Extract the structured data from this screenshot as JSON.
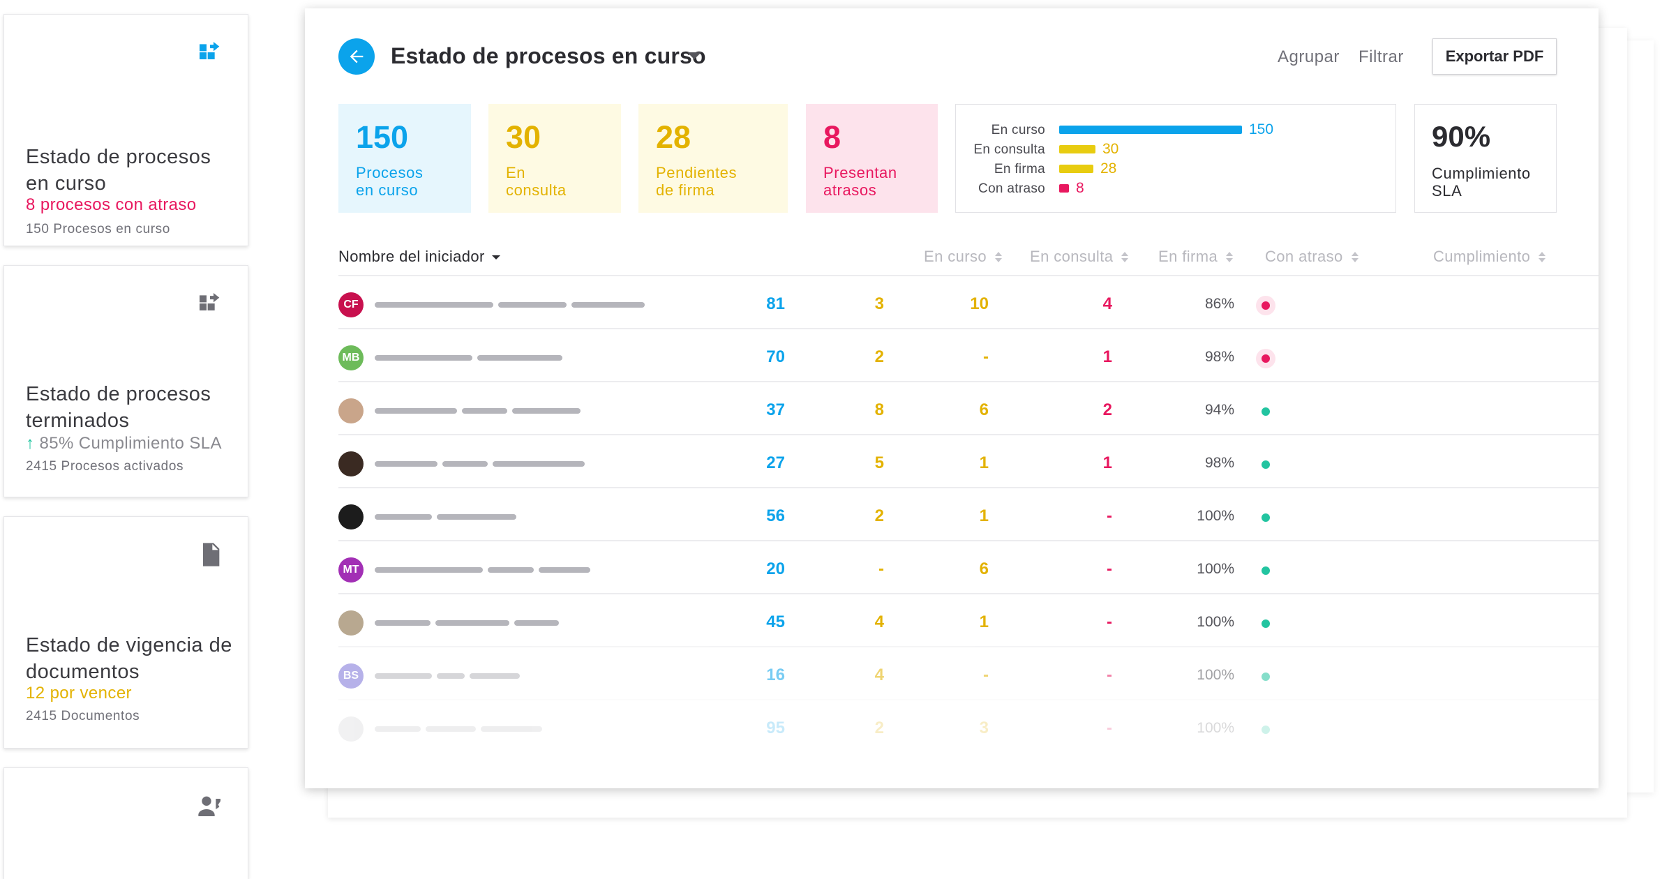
{
  "colors": {
    "blue": "#0ba3eb",
    "yellow": "#e3b200",
    "yellow_bar": "#e8cc10",
    "pink": "#e8185f",
    "green": "#22c4a0",
    "blue_bg": "#e6f6fd",
    "yellow_bg": "#fefae3",
    "pink_bg": "#fde3ec"
  },
  "cards": [
    {
      "icon": "process-export-icon",
      "title": "Estado de procesos en curso",
      "subtitle": "8 procesos con atraso",
      "meta": "150 Procesos en curso"
    },
    {
      "icon": "process-export-icon",
      "title": "Estado de procesos terminados",
      "subtitle": "85% Cumplimiento SLA",
      "meta": "2415 Procesos activados"
    },
    {
      "icon": "document-icon",
      "title": "Estado de vigencia de documentos",
      "subtitle": "12 por vencer",
      "meta": "2415 Documentos"
    },
    {
      "icon": "contact-icon"
    }
  ],
  "panel": {
    "title": "Estado de procesos en curso",
    "actions": {
      "group": "Agrupar",
      "filter": "Filtrar",
      "export": "Exportar PDF"
    },
    "stats": [
      {
        "value": "150",
        "label_line1": "Procesos",
        "label_line2": "en curso"
      },
      {
        "value": "30",
        "label_line1": "En",
        "label_line2": "consulta"
      },
      {
        "value": "28",
        "label_line1": "Pendientes",
        "label_line2": "de firma"
      },
      {
        "value": "8",
        "label_line1": "Presentan",
        "label_line2": "atrasos"
      }
    ],
    "bars": [
      {
        "label": "En curso",
        "value": 150
      },
      {
        "label": "En consulta",
        "value": 30
      },
      {
        "label": "En firma",
        "value": 28
      },
      {
        "label": "Con atraso",
        "value": 8
      }
    ],
    "sla": {
      "value": "90%",
      "label_line1": "Cumplimiento",
      "label_line2": "SLA"
    },
    "columns": [
      "Nombre del iniciador",
      "En curso",
      "En consulta",
      "En firma",
      "Con atraso",
      "Cumplimiento"
    ],
    "rows": [
      {
        "initials": "CF",
        "avatar_color": "#c8104e",
        "en_curso": "81",
        "en_consulta": "3",
        "en_firma": "10",
        "con_atraso": "4",
        "cumplimiento": "86%",
        "status": "alert"
      },
      {
        "initials": "MB",
        "avatar_color": "#6dbb5a",
        "en_curso": "70",
        "en_consulta": "2",
        "en_firma": "-",
        "con_atraso": "1",
        "cumplimiento": "98%",
        "status": "alert"
      },
      {
        "initials": "",
        "avatar_color": "#c9a58a",
        "en_curso": "37",
        "en_consulta": "8",
        "en_firma": "6",
        "con_atraso": "2",
        "cumplimiento": "94%",
        "status": "ok"
      },
      {
        "initials": "",
        "avatar_color": "#3a2a22",
        "en_curso": "27",
        "en_consulta": "5",
        "en_firma": "1",
        "con_atraso": "1",
        "cumplimiento": "98%",
        "status": "ok"
      },
      {
        "initials": "",
        "avatar_color": "#1c1c1c",
        "en_curso": "56",
        "en_consulta": "2",
        "en_firma": "1",
        "con_atraso": "-",
        "cumplimiento": "100%",
        "status": "ok"
      },
      {
        "initials": "MT",
        "avatar_color": "#a22fb5",
        "en_curso": "20",
        "en_consulta": "-",
        "en_firma": "6",
        "con_atraso": "-",
        "cumplimiento": "100%",
        "status": "ok"
      },
      {
        "initials": "",
        "avatar_color": "#b8a890",
        "en_curso": "45",
        "en_consulta": "4",
        "en_firma": "1",
        "con_atraso": "-",
        "cumplimiento": "100%",
        "status": "ok"
      },
      {
        "initials": "BS",
        "avatar_color": "#7b72d8",
        "en_curso": "16",
        "en_consulta": "4",
        "en_firma": "-",
        "con_atraso": "-",
        "cumplimiento": "100%",
        "status": "ok"
      },
      {
        "initials": "",
        "avatar_color": "#c0c0c4",
        "en_curso": "95",
        "en_consulta": "2",
        "en_firma": "3",
        "con_atraso": "-",
        "cumplimiento": "100%",
        "status": "ok"
      }
    ]
  }
}
